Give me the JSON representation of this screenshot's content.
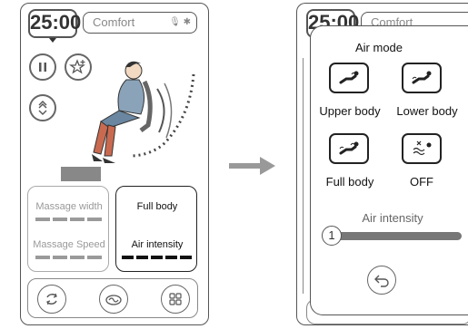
{
  "left_screen": {
    "timer": "25:00",
    "mode": "Comfort",
    "cards": {
      "massage_width": "Massage width",
      "massage_speed": "Massage Speed",
      "full_body": "Full body",
      "air_intensity": "Air intensity"
    }
  },
  "right_screen": {
    "timer": "25:00",
    "mode": "Comfort",
    "popup": {
      "title": "Air mode",
      "options": [
        {
          "label": "Upper body",
          "icon": "upper-body-air-icon"
        },
        {
          "label": "Lower body",
          "icon": "lower-body-air-icon"
        },
        {
          "label": "Full body",
          "icon": "full-body-air-icon"
        },
        {
          "label": "OFF",
          "icon": "air-off-icon"
        }
      ],
      "intensity_label": "Air intensity",
      "intensity_value": "1"
    }
  },
  "colors": {
    "gray_dash": "#9a9a9a",
    "black_dash": "#111111",
    "slider_bar": "#777777",
    "arrow": "#999999"
  }
}
